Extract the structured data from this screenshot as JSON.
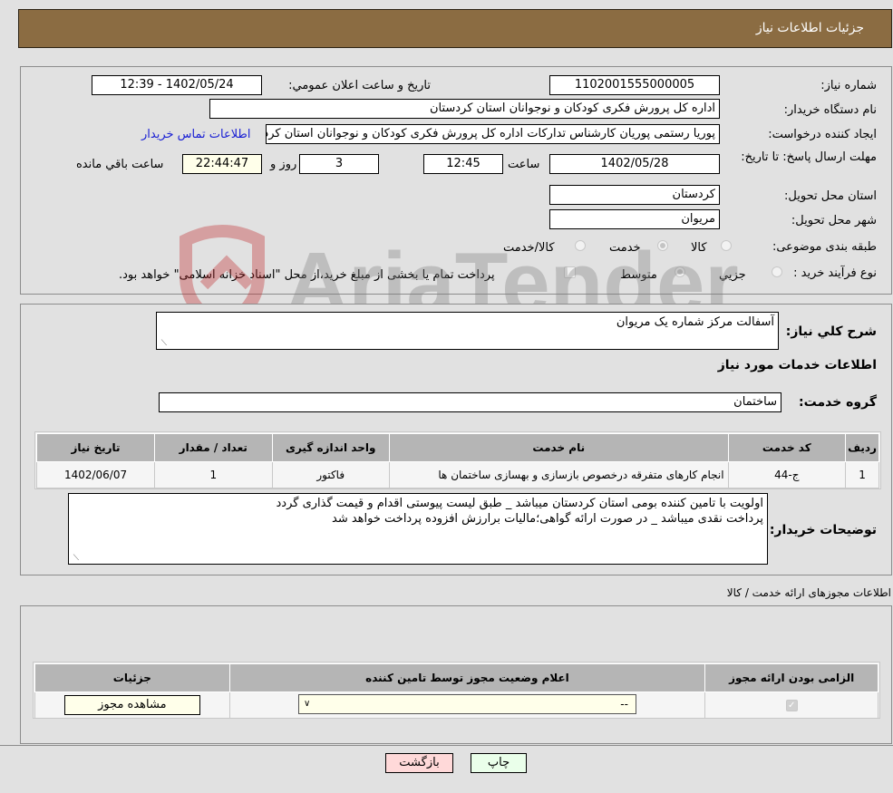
{
  "header": {
    "title": "جزئیات اطلاعات نیاز"
  },
  "fields": {
    "need_number_label": "شماره نیاز:",
    "need_number": "1102001555000005",
    "announce_label": "تاریخ و ساعت اعلان عمومي:",
    "announce_value": "1402/05/24 - 12:39",
    "buyer_org_label": "نام دستگاه خریدار:",
    "buyer_org": "اداره کل پرورش فکری کودکان و نوجوانان استان کردستان",
    "requester_label": "ایجاد کننده درخواست:",
    "requester": "پوريا رستمی پوريان کارشناس تدارکات اداره کل پرورش فکری کودکان و نوجوانان استان کردستان",
    "contact_link": "اطلاعات تماس خریدار",
    "deadline_label": "مهلت ارسال پاسخ: تا تاریخ:",
    "deadline_date": "1402/05/28",
    "time_label": "ساعت",
    "deadline_time": "12:45",
    "days_value": "3",
    "days_label": "روز و",
    "remaining_time": "22:44:47",
    "remaining_label": "ساعت باقي مانده",
    "province_label": "استان محل تحویل:",
    "province": "کردستان",
    "city_label": "شهر محل تحویل:",
    "city": "مریوان",
    "category_label": "طبقه بندی موضوعی:",
    "category_options": [
      "کالا",
      "خدمت",
      "کالا/خدمت"
    ],
    "category_selected": "خدمت",
    "process_label": "نوع فرآیند خرید :",
    "process_options": [
      "جزيي",
      "متوسط"
    ],
    "process_selected": "متوسط",
    "treasury_text": "پرداخت تمام یا بخشی از مبلغ خرید،از محل \"اسناد خزانه اسلامی\" خواهد بود."
  },
  "description": {
    "label": "شرح کلي نیاز:",
    "value": "آسفالت مرکز شماره یک مریوان",
    "services_title": "اطلاعات خدمات مورد نیاز",
    "group_label": "گروه خدمت:",
    "group_value": "ساختمان"
  },
  "services_table": {
    "headers": [
      "ردیف",
      "کد خدمت",
      "نام خدمت",
      "واحد اندازه گیری",
      "تعداد / مقدار",
      "تاریخ نیاز"
    ],
    "rows": [
      [
        "1",
        "ج-44",
        "انجام کارهای متفرقه درخصوص بازسازی و بهسازی ساختمان ها",
        "فاکتور",
        "1",
        "1402/06/07"
      ]
    ]
  },
  "buyer_notes": {
    "label": "توضیحات خریدار:",
    "line1": "اولویت با تامین کننده بومی استان کردستان میباشد _ طبق لیست پیوستی اقدام و قیمت گذاری گردد",
    "line2": "پرداخت نقدی میباشد _ در صورت ارائه گواهی؛مالیات برارزش افزوده پرداخت خواهد شد"
  },
  "permits": {
    "title": "اطلاعات مجوزهای ارائه خدمت / کالا",
    "headers": [
      "الزامی بودن ارائه مجوز",
      "اعلام وضعیت مجوز توسط تامین کننده",
      "جزئیات"
    ],
    "required_checked": true,
    "status_selected": "--",
    "view_button": "مشاهده مجوز"
  },
  "buttons": {
    "print": "چاپ",
    "back": "بازگشت"
  },
  "watermark": "AriaTender.neT",
  "colors": {
    "header_bg": "#8b6c42",
    "link": "#1a20d4",
    "back_bg": "#ffd9d9",
    "print_bg": "#eaffea"
  }
}
